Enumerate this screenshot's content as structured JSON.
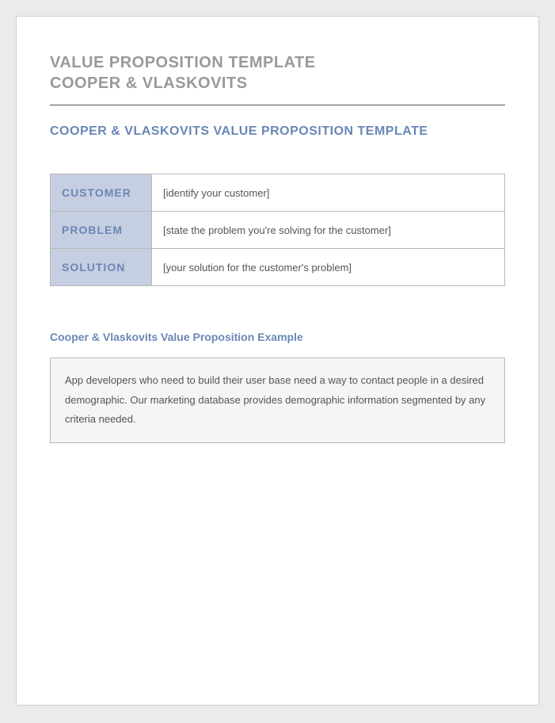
{
  "header": {
    "title_line1": "VALUE PROPOSITION TEMPLATE",
    "title_line2": "COOPER & VLASKOVITS"
  },
  "subtitle": "COOPER & VLASKOVITS VALUE PROPOSITION TEMPLATE",
  "table": {
    "rows": [
      {
        "label": "CUSTOMER",
        "value": "[identify your customer]"
      },
      {
        "label": "PROBLEM",
        "value": "[state the problem you're solving for the customer]"
      },
      {
        "label": "SOLUTION",
        "value": "[your solution for the customer's problem]"
      }
    ]
  },
  "example": {
    "title": "Cooper & Vlaskovits Value Proposition Example",
    "body": "App developers who need to build their user base need a way to contact people in a desired demographic. Our marketing database provides demographic information segmented by any criteria needed."
  }
}
